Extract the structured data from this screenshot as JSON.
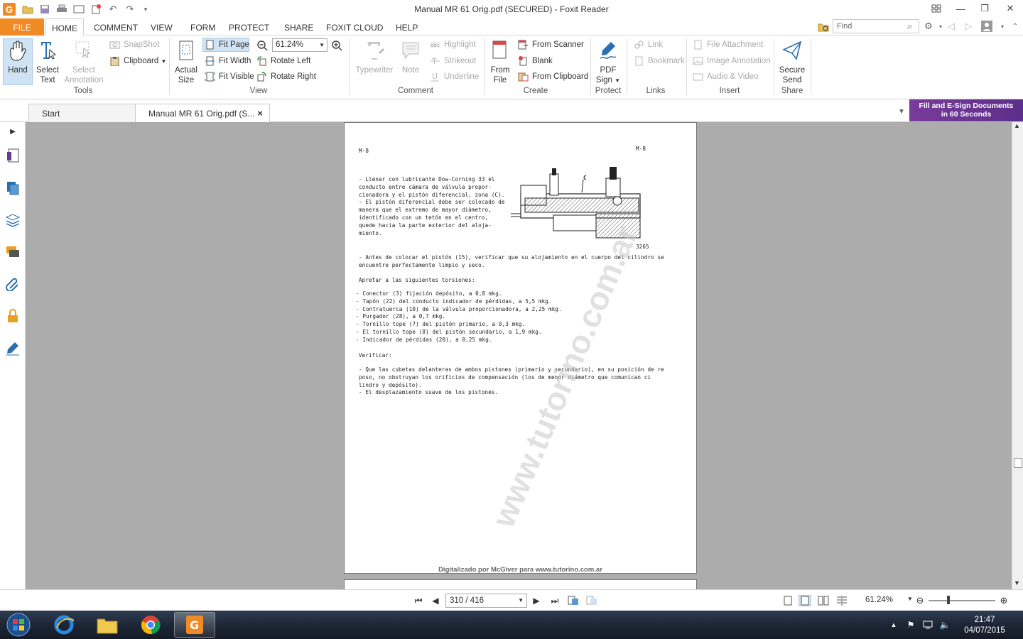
{
  "window": {
    "title": "Manual MR 61 Orig.pdf (SECURED) - Foxit Reader"
  },
  "menu": {
    "file": "FILE",
    "home": "HOME",
    "comment": "COMMENT",
    "view": "VIEW",
    "form": "FORM",
    "protect": "PROTECT",
    "share": "SHARE",
    "foxit_cloud": "FOXIT CLOUD",
    "help": "HELP"
  },
  "search": {
    "placeholder": "Find"
  },
  "ribbon": {
    "tools": {
      "hand": "Hand",
      "select_text_1": "Select",
      "select_text_2": "Text",
      "select_annotation_1": "Select",
      "select_annotation_2": "Annotation",
      "snapshot": "SnapShot",
      "clipboard": "Clipboard",
      "label": "Tools"
    },
    "view": {
      "actual_size_1": "Actual",
      "actual_size_2": "Size",
      "fit_page": "Fit Page",
      "fit_width": "Fit Width",
      "fit_visible": "Fit Visible",
      "zoom": "61.24%",
      "rotate_left": "Rotate Left",
      "rotate_right": "Rotate Right",
      "label": "View"
    },
    "comment": {
      "typewriter": "Typewriter",
      "note": "Note",
      "highlight": "Highlight",
      "strikeout": "Strikeout",
      "underline": "Underline",
      "label": "Comment"
    },
    "create": {
      "from_file_1": "From",
      "from_file_2": "File",
      "from_scanner": "From Scanner",
      "blank": "Blank",
      "from_clipboard": "From Clipboard",
      "label": "Create"
    },
    "protect": {
      "pdf_sign_1": "PDF",
      "pdf_sign_2": "Sign",
      "label": "Protect"
    },
    "links": {
      "link": "Link",
      "bookmark": "Bookmark",
      "label": "Links"
    },
    "insert": {
      "file_attachment": "File Attachment",
      "image_annotation": "Image Annotation",
      "audio_video": "Audio & Video",
      "label": "Insert"
    },
    "share": {
      "secure_send_1": "Secure",
      "secure_send_2": "Send",
      "label": "Share"
    }
  },
  "tabs": [
    {
      "label": "Start"
    },
    {
      "label": "Manual MR 61 Orig.pdf (S..."
    }
  ],
  "promo": {
    "line1": "Fill and E-Sign Documents",
    "line2": "in 60 Seconds"
  },
  "document": {
    "header_left": "M-8",
    "header_right": "M-8",
    "figure_label_c": "C",
    "figure_number": "3265",
    "bullets_1": [
      "- Llenar con lubricante Dow-Corning 33 el",
      "  conducto entre cámara de válvula propor-",
      "  cionadora y el pistón diferencial, zona (C).",
      "- El pistón diferencial debe ser colocado de",
      "  manera que el extremo de mayor diámetro,",
      "  identificado con un tetón en el centro,",
      "  quede hacia la parte exterior del aloja-",
      "  miento."
    ],
    "para_antes": [
      "- Antes de colocar el pistón (15), verificar que su alojamiento en el cuerpo del cilindro se",
      "  encuentre perfectamente limpio y seco."
    ],
    "apretar_heading": "Apretar a las siguientes torsiones:",
    "torsiones": [
      "- Conector (3) fijación depósito, a 0,8 mkg.",
      "- Tapón (22) del conducto indicador de pérdidas, a 5,5 mkg.",
      "- Contratuerca (10) de la válvula proporcionadora, a 2,25 mkg.",
      "- Purgador (28), a 0,7 mkg.",
      "- Tornillo tope (7) del pistón primario, a 0,3 mkg.",
      "- El tornillo tope (8) del pistón secundario, a 1,9 mkg.",
      "- Indicador de pérdidas (20), a 0,25 mkg."
    ],
    "verificar_heading": "Verificar:",
    "verificar": [
      "- Que las cubetas delanteras de ambos pistones (primario y secundario), en su posición de re",
      "  poso, no obstruyan los orificios de compensación (los de menor diámetro que comunican ci",
      "  lindro y depósito).",
      "- El desplazamiento suave de los pistones."
    ],
    "watermark": "www.tutorino.com.ar",
    "footer": "Digitalizado por McGiver para www.tutorino.com.ar"
  },
  "status": {
    "page": "310 / 416",
    "zoom": "61.24%"
  },
  "taskbar": {
    "time": "21:47",
    "date": "04/07/2015"
  },
  "colors": {
    "accent": "#f08a24",
    "selected": "#cfe3f5",
    "docbg": "#acacac",
    "promo": "#6a358f"
  }
}
